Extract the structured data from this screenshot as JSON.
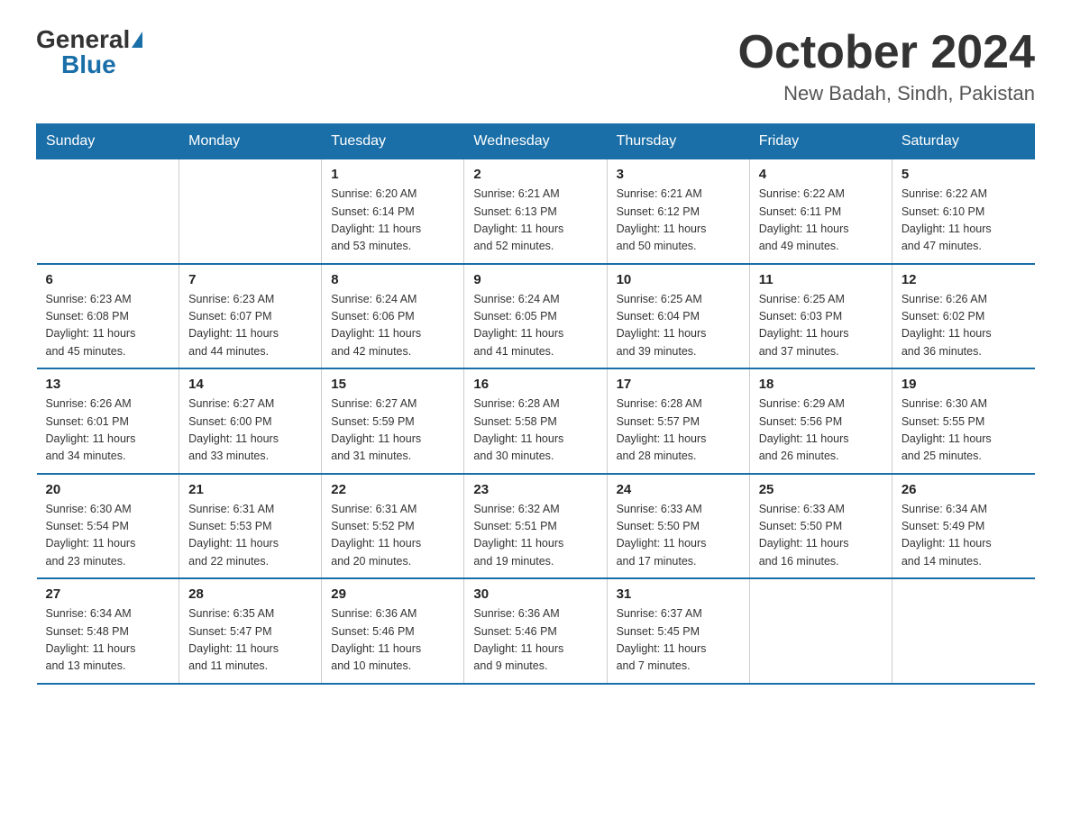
{
  "header": {
    "logo_general": "General",
    "logo_blue": "Blue",
    "month_title": "October 2024",
    "location": "New Badah, Sindh, Pakistan"
  },
  "weekdays": [
    "Sunday",
    "Monday",
    "Tuesday",
    "Wednesday",
    "Thursday",
    "Friday",
    "Saturday"
  ],
  "weeks": [
    [
      {
        "day": "",
        "info": ""
      },
      {
        "day": "",
        "info": ""
      },
      {
        "day": "1",
        "info": "Sunrise: 6:20 AM\nSunset: 6:14 PM\nDaylight: 11 hours\nand 53 minutes."
      },
      {
        "day": "2",
        "info": "Sunrise: 6:21 AM\nSunset: 6:13 PM\nDaylight: 11 hours\nand 52 minutes."
      },
      {
        "day": "3",
        "info": "Sunrise: 6:21 AM\nSunset: 6:12 PM\nDaylight: 11 hours\nand 50 minutes."
      },
      {
        "day": "4",
        "info": "Sunrise: 6:22 AM\nSunset: 6:11 PM\nDaylight: 11 hours\nand 49 minutes."
      },
      {
        "day": "5",
        "info": "Sunrise: 6:22 AM\nSunset: 6:10 PM\nDaylight: 11 hours\nand 47 minutes."
      }
    ],
    [
      {
        "day": "6",
        "info": "Sunrise: 6:23 AM\nSunset: 6:08 PM\nDaylight: 11 hours\nand 45 minutes."
      },
      {
        "day": "7",
        "info": "Sunrise: 6:23 AM\nSunset: 6:07 PM\nDaylight: 11 hours\nand 44 minutes."
      },
      {
        "day": "8",
        "info": "Sunrise: 6:24 AM\nSunset: 6:06 PM\nDaylight: 11 hours\nand 42 minutes."
      },
      {
        "day": "9",
        "info": "Sunrise: 6:24 AM\nSunset: 6:05 PM\nDaylight: 11 hours\nand 41 minutes."
      },
      {
        "day": "10",
        "info": "Sunrise: 6:25 AM\nSunset: 6:04 PM\nDaylight: 11 hours\nand 39 minutes."
      },
      {
        "day": "11",
        "info": "Sunrise: 6:25 AM\nSunset: 6:03 PM\nDaylight: 11 hours\nand 37 minutes."
      },
      {
        "day": "12",
        "info": "Sunrise: 6:26 AM\nSunset: 6:02 PM\nDaylight: 11 hours\nand 36 minutes."
      }
    ],
    [
      {
        "day": "13",
        "info": "Sunrise: 6:26 AM\nSunset: 6:01 PM\nDaylight: 11 hours\nand 34 minutes."
      },
      {
        "day": "14",
        "info": "Sunrise: 6:27 AM\nSunset: 6:00 PM\nDaylight: 11 hours\nand 33 minutes."
      },
      {
        "day": "15",
        "info": "Sunrise: 6:27 AM\nSunset: 5:59 PM\nDaylight: 11 hours\nand 31 minutes."
      },
      {
        "day": "16",
        "info": "Sunrise: 6:28 AM\nSunset: 5:58 PM\nDaylight: 11 hours\nand 30 minutes."
      },
      {
        "day": "17",
        "info": "Sunrise: 6:28 AM\nSunset: 5:57 PM\nDaylight: 11 hours\nand 28 minutes."
      },
      {
        "day": "18",
        "info": "Sunrise: 6:29 AM\nSunset: 5:56 PM\nDaylight: 11 hours\nand 26 minutes."
      },
      {
        "day": "19",
        "info": "Sunrise: 6:30 AM\nSunset: 5:55 PM\nDaylight: 11 hours\nand 25 minutes."
      }
    ],
    [
      {
        "day": "20",
        "info": "Sunrise: 6:30 AM\nSunset: 5:54 PM\nDaylight: 11 hours\nand 23 minutes."
      },
      {
        "day": "21",
        "info": "Sunrise: 6:31 AM\nSunset: 5:53 PM\nDaylight: 11 hours\nand 22 minutes."
      },
      {
        "day": "22",
        "info": "Sunrise: 6:31 AM\nSunset: 5:52 PM\nDaylight: 11 hours\nand 20 minutes."
      },
      {
        "day": "23",
        "info": "Sunrise: 6:32 AM\nSunset: 5:51 PM\nDaylight: 11 hours\nand 19 minutes."
      },
      {
        "day": "24",
        "info": "Sunrise: 6:33 AM\nSunset: 5:50 PM\nDaylight: 11 hours\nand 17 minutes."
      },
      {
        "day": "25",
        "info": "Sunrise: 6:33 AM\nSunset: 5:50 PM\nDaylight: 11 hours\nand 16 minutes."
      },
      {
        "day": "26",
        "info": "Sunrise: 6:34 AM\nSunset: 5:49 PM\nDaylight: 11 hours\nand 14 minutes."
      }
    ],
    [
      {
        "day": "27",
        "info": "Sunrise: 6:34 AM\nSunset: 5:48 PM\nDaylight: 11 hours\nand 13 minutes."
      },
      {
        "day": "28",
        "info": "Sunrise: 6:35 AM\nSunset: 5:47 PM\nDaylight: 11 hours\nand 11 minutes."
      },
      {
        "day": "29",
        "info": "Sunrise: 6:36 AM\nSunset: 5:46 PM\nDaylight: 11 hours\nand 10 minutes."
      },
      {
        "day": "30",
        "info": "Sunrise: 6:36 AM\nSunset: 5:46 PM\nDaylight: 11 hours\nand 9 minutes."
      },
      {
        "day": "31",
        "info": "Sunrise: 6:37 AM\nSunset: 5:45 PM\nDaylight: 11 hours\nand 7 minutes."
      },
      {
        "day": "",
        "info": ""
      },
      {
        "day": "",
        "info": ""
      }
    ]
  ]
}
